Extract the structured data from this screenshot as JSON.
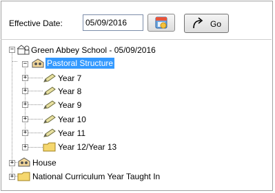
{
  "toolbar": {
    "effective_date_label": "Effective Date:",
    "effective_date_value": "05/09/2016",
    "go_label": "Go"
  },
  "tree": {
    "root": "Green Abbey School - 05/09/2016",
    "pastoral": "Pastoral Structure",
    "years": [
      "Year  7",
      "Year  8",
      "Year  9",
      "Year 10",
      "Year 11",
      "Year 12/Year 13"
    ],
    "house": "House",
    "national": "National Curriculum Year Taught In"
  },
  "colors": {
    "selection": "#3399ff",
    "folder": "#f5d76e",
    "pencil": "#e8e0a0"
  }
}
